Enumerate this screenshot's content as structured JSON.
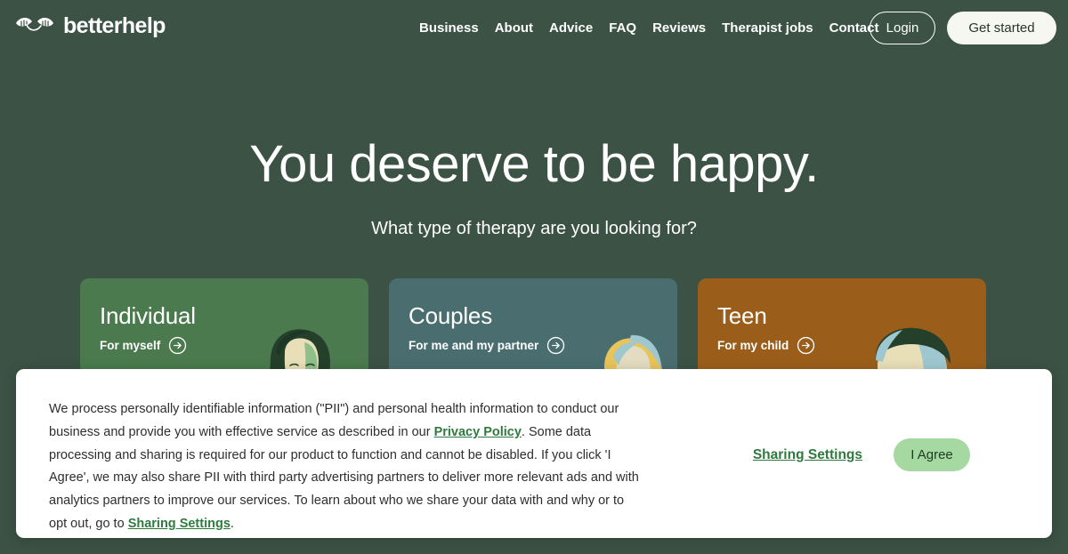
{
  "header": {
    "logo_text": "betterhelp",
    "logo_icon": "betterhelp-leaf-logo",
    "nav_items": [
      {
        "label": "Business"
      },
      {
        "label": "About"
      },
      {
        "label": "Advice"
      },
      {
        "label": "FAQ"
      },
      {
        "label": "Reviews"
      },
      {
        "label": "Therapist jobs"
      },
      {
        "label": "Contact"
      }
    ],
    "login_label": "Login",
    "get_started_label": "Get started"
  },
  "hero": {
    "title": "You deserve to be happy.",
    "subtitle": "What type of therapy are you looking for?"
  },
  "cards": [
    {
      "title": "Individual",
      "subtitle": "For myself",
      "color": "#4a7a4e",
      "arrow_icon": "arrow-right-circle-icon",
      "art": "woman-illustration"
    },
    {
      "title": "Couples",
      "subtitle": "For me and my partner",
      "color": "#4a6e70",
      "arrow_icon": "arrow-right-circle-icon",
      "art": "couple-illustration"
    },
    {
      "title": "Teen",
      "subtitle": "For my child",
      "color": "#9a5e1a",
      "arrow_icon": "arrow-right-circle-icon",
      "art": "teen-illustration"
    }
  ],
  "consent_banner": {
    "text_part1": "We process personally identifiable information (\"PII\") and personal health information to conduct our business and provide you with effective service as described in our ",
    "privacy_policy_link": "Privacy Policy",
    "text_part2": ". Some data processing and sharing is required for our product to function and cannot be disabled. If you click 'I Agree', we may also share PII with third party advertising partners to deliver more relevant ads and with analytics partners to improve our services. To learn about who we share your data with and why or to opt out, go to ",
    "sharing_settings_inline_link": "Sharing Settings",
    "text_part3": ".",
    "sharing_settings_label": "Sharing Settings",
    "agree_label": "I Agree",
    "accent_color": "#2f7a3f",
    "agree_button_color": "#a5d9a1"
  },
  "theme": {
    "background": "#3b5245",
    "text_on_dark": "#ffffff"
  }
}
